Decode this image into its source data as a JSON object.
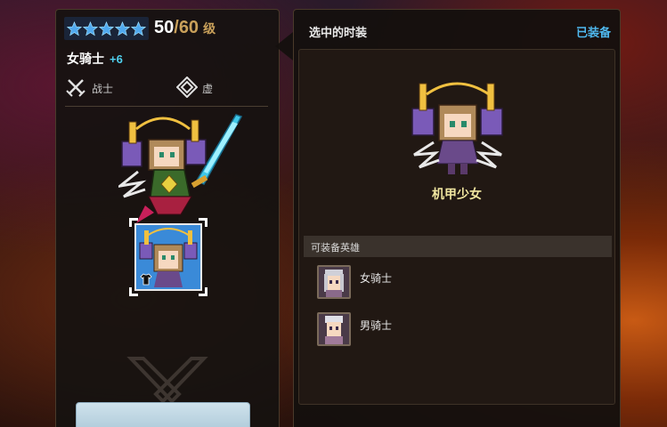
{
  "hero": {
    "stars": 5,
    "level_current": "50",
    "level_separator": "/",
    "level_max": "60",
    "level_unit": "级",
    "name": "女骑士",
    "enhance": "+6",
    "class_label": "战士",
    "element_label": "虚"
  },
  "skin_panel": {
    "header": "选中的时装",
    "equipped_label": "已装备",
    "skin_name": "机甲少女",
    "equippable_heroes_header": "可装备英雄",
    "heroes": [
      {
        "name": "女骑士"
      },
      {
        "name": "男骑士"
      }
    ]
  },
  "colors": {
    "accent_blue": "#4fb8ee",
    "enhance_cyan": "#4fd0ee",
    "level_gold": "#c9a05a",
    "skin_name_yellow": "#f0e6a0"
  },
  "icons": {
    "star": "star-icon",
    "class": "crossed-swords-icon",
    "element": "void-diamond-icon",
    "skin_badge": "shirt-icon"
  }
}
